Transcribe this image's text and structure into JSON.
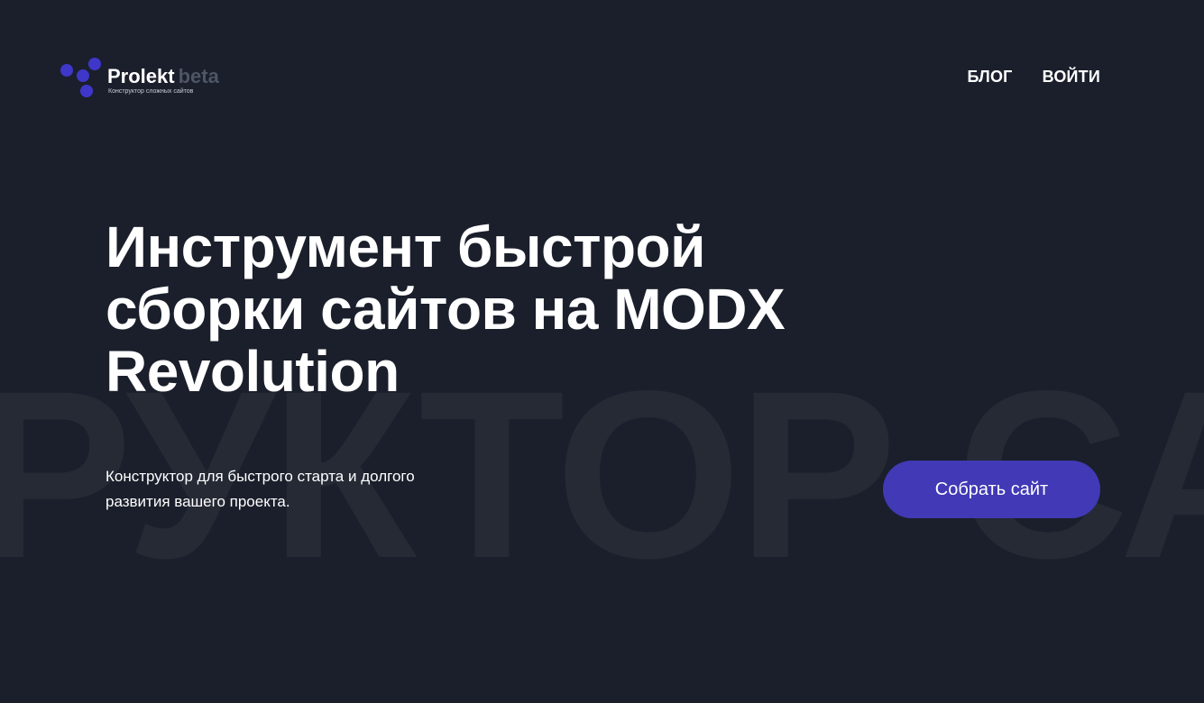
{
  "background_word": "руктор са",
  "brand": {
    "name": "Prolekt",
    "badge": "beta",
    "tagline": "Конструктор сложных сайтов",
    "logo_icon": "dots-logo-icon",
    "accent_color": "#4139b5"
  },
  "nav": {
    "items": [
      {
        "label": "БЛОГ"
      },
      {
        "label": "ВОЙТИ"
      }
    ]
  },
  "hero": {
    "title_lines": [
      "Инструмент быстрой",
      "сборки сайтов на MODX",
      "Revolution"
    ],
    "subtitle_lines": [
      "Конструктор для быстрого старта и долгого",
      "развития вашего проекта."
    ],
    "cta_label": "Собрать сайт"
  },
  "colors": {
    "background": "#1a1f2b",
    "watermark_text": "#252a35",
    "badge_text": "#4e5565",
    "button": "#4139b5"
  }
}
